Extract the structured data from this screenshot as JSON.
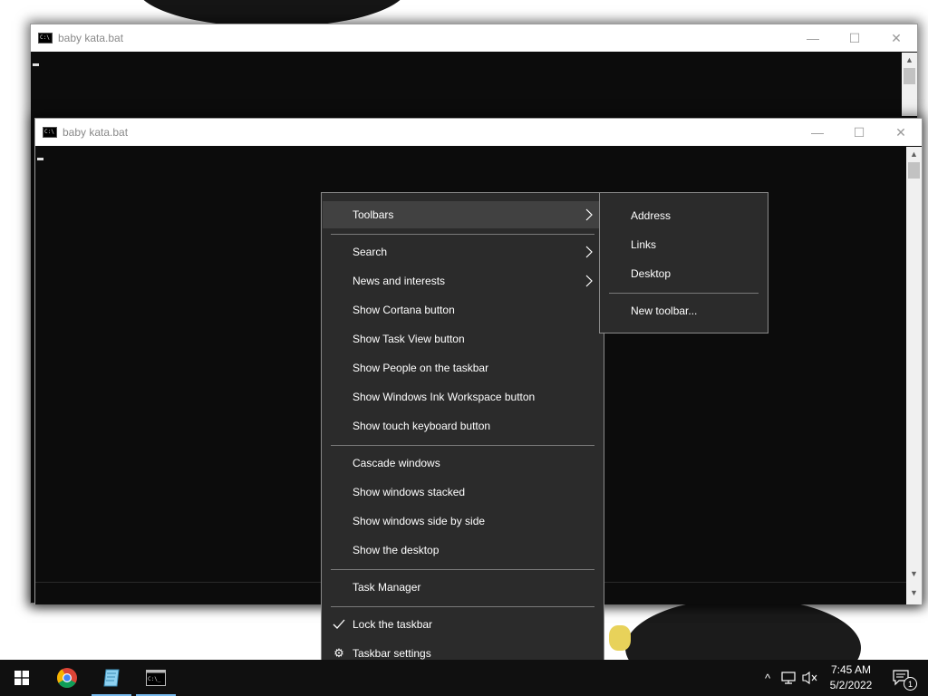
{
  "windows": [
    {
      "title": "baby kata.bat",
      "minimize": "—",
      "maximize": "☐",
      "close": "✕"
    },
    {
      "title": "baby kata.bat",
      "minimize": "—",
      "maximize": "☐",
      "close": "✕"
    }
  ],
  "context_menu": {
    "items": [
      {
        "label": "Toolbars",
        "submenu": true,
        "highlighted": true
      },
      {
        "label": "Search",
        "submenu": true
      },
      {
        "label": "News and interests",
        "submenu": true
      },
      {
        "label": "Show Cortana button"
      },
      {
        "label": "Show Task View button"
      },
      {
        "label": "Show People on the taskbar"
      },
      {
        "label": "Show Windows Ink Workspace button"
      },
      {
        "label": "Show touch keyboard button"
      },
      {
        "label": "Cascade windows"
      },
      {
        "label": "Show windows stacked"
      },
      {
        "label": "Show windows side by side"
      },
      {
        "label": "Show the desktop"
      },
      {
        "label": "Task Manager"
      },
      {
        "label": "Lock the taskbar",
        "checked": true,
        "icon": "checkmark-icon"
      },
      {
        "label": "Taskbar settings",
        "icon": "gear-icon"
      }
    ]
  },
  "toolbars_submenu": {
    "items": [
      {
        "label": "Address"
      },
      {
        "label": "Links"
      },
      {
        "label": "Desktop"
      },
      {
        "label": "New toolbar..."
      }
    ]
  },
  "taskbar": {
    "apps": [
      {
        "name": "start-button",
        "icon": "windows-logo-icon"
      },
      {
        "name": "chrome",
        "icon": "chrome-icon"
      },
      {
        "name": "notepad-app",
        "icon": "notepad-icon",
        "active": true
      },
      {
        "name": "command-prompt",
        "icon": "cmd-icon",
        "active": true
      }
    ],
    "tray": {
      "show_hidden": "^",
      "notification_count": "1"
    },
    "clock": {
      "time": "7:45 AM",
      "date": "5/2/2022"
    }
  },
  "colors": {
    "menu_bg": "#2b2b2b",
    "menu_highlight": "#414141",
    "taskbar_bg": "#101010",
    "active_indicator": "#76b9ed",
    "console_bg": "#0c0c0c"
  }
}
